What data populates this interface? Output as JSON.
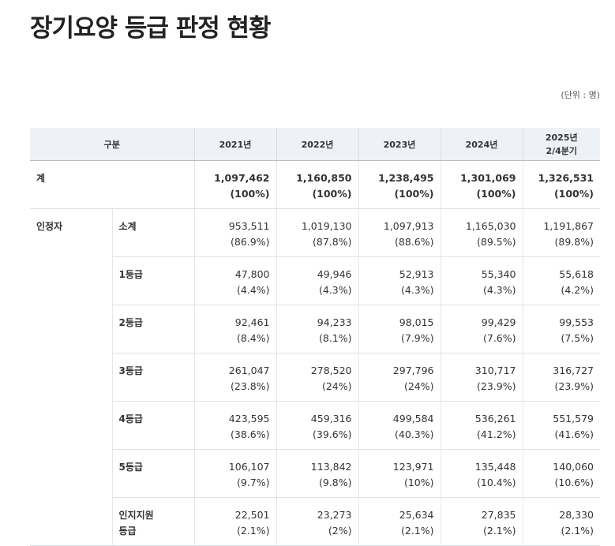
{
  "page": {
    "title": "장기요양 등급 판정 현황",
    "unit": "(단위 : 명)"
  },
  "table": {
    "header": {
      "category": "구분",
      "years": [
        "2021년",
        "2022년",
        "2023년",
        "2024년"
      ],
      "last_year_line1": "2025년",
      "last_year_line2": "2/4분기"
    },
    "total": {
      "label": "계",
      "values": [
        {
          "count": "1,097,462",
          "pct": "(100%)"
        },
        {
          "count": "1,160,850",
          "pct": "(100%)"
        },
        {
          "count": "1,238,495",
          "pct": "(100%)"
        },
        {
          "count": "1,301,069",
          "pct": "(100%)"
        },
        {
          "count": "1,326,531",
          "pct": "(100%)"
        }
      ]
    },
    "group_label": "인정자",
    "rows": [
      {
        "label": "소계",
        "values": [
          {
            "count": "953,511",
            "pct": "(86.9%)"
          },
          {
            "count": "1,019,130",
            "pct": "(87.8%)"
          },
          {
            "count": "1,097,913",
            "pct": "(88.6%)"
          },
          {
            "count": "1,165,030",
            "pct": "(89.5%)"
          },
          {
            "count": "1,191,867",
            "pct": "(89.8%)"
          }
        ]
      },
      {
        "label": "1등급",
        "values": [
          {
            "count": "47,800",
            "pct": "(4.4%)"
          },
          {
            "count": "49,946",
            "pct": "(4.3%)"
          },
          {
            "count": "52,913",
            "pct": "(4.3%)"
          },
          {
            "count": "55,340",
            "pct": "(4.3%)"
          },
          {
            "count": "55,618",
            "pct": "(4.2%)"
          }
        ]
      },
      {
        "label": "2등급",
        "values": [
          {
            "count": "92,461",
            "pct": "(8.4%)"
          },
          {
            "count": "94,233",
            "pct": "(8.1%)"
          },
          {
            "count": "98,015",
            "pct": "(7.9%)"
          },
          {
            "count": "99,429",
            "pct": "(7.6%)"
          },
          {
            "count": "99,553",
            "pct": "(7.5%)"
          }
        ]
      },
      {
        "label": "3등급",
        "values": [
          {
            "count": "261,047",
            "pct": "(23.8%)"
          },
          {
            "count": "278,520",
            "pct": "(24%)"
          },
          {
            "count": "297,796",
            "pct": "(24%)"
          },
          {
            "count": "310,717",
            "pct": "(23.9%)"
          },
          {
            "count": "316,727",
            "pct": "(23.9%)"
          }
        ]
      },
      {
        "label": "4등급",
        "values": [
          {
            "count": "423,595",
            "pct": "(38.6%)"
          },
          {
            "count": "459,316",
            "pct": "(39.6%)"
          },
          {
            "count": "499,584",
            "pct": "(40.3%)"
          },
          {
            "count": "536,261",
            "pct": "(41.2%)"
          },
          {
            "count": "551,579",
            "pct": "(41.6%)"
          }
        ]
      },
      {
        "label": "5등급",
        "values": [
          {
            "count": "106,107",
            "pct": "(9.7%)"
          },
          {
            "count": "113,842",
            "pct": "(9.8%)"
          },
          {
            "count": "123,971",
            "pct": "(10%)"
          },
          {
            "count": "135,448",
            "pct": "(10.4%)"
          },
          {
            "count": "140,060",
            "pct": "(10.6%)"
          }
        ]
      },
      {
        "label": "인지지원\n등급",
        "values": [
          {
            "count": "22,501",
            "pct": "(2.1%)"
          },
          {
            "count": "23,273",
            "pct": "(2%)"
          },
          {
            "count": "25,634",
            "pct": "(2.1%)"
          },
          {
            "count": "27,835",
            "pct": "(2.1%)"
          },
          {
            "count": "28,330",
            "pct": "(2.1%)"
          }
        ]
      }
    ]
  }
}
